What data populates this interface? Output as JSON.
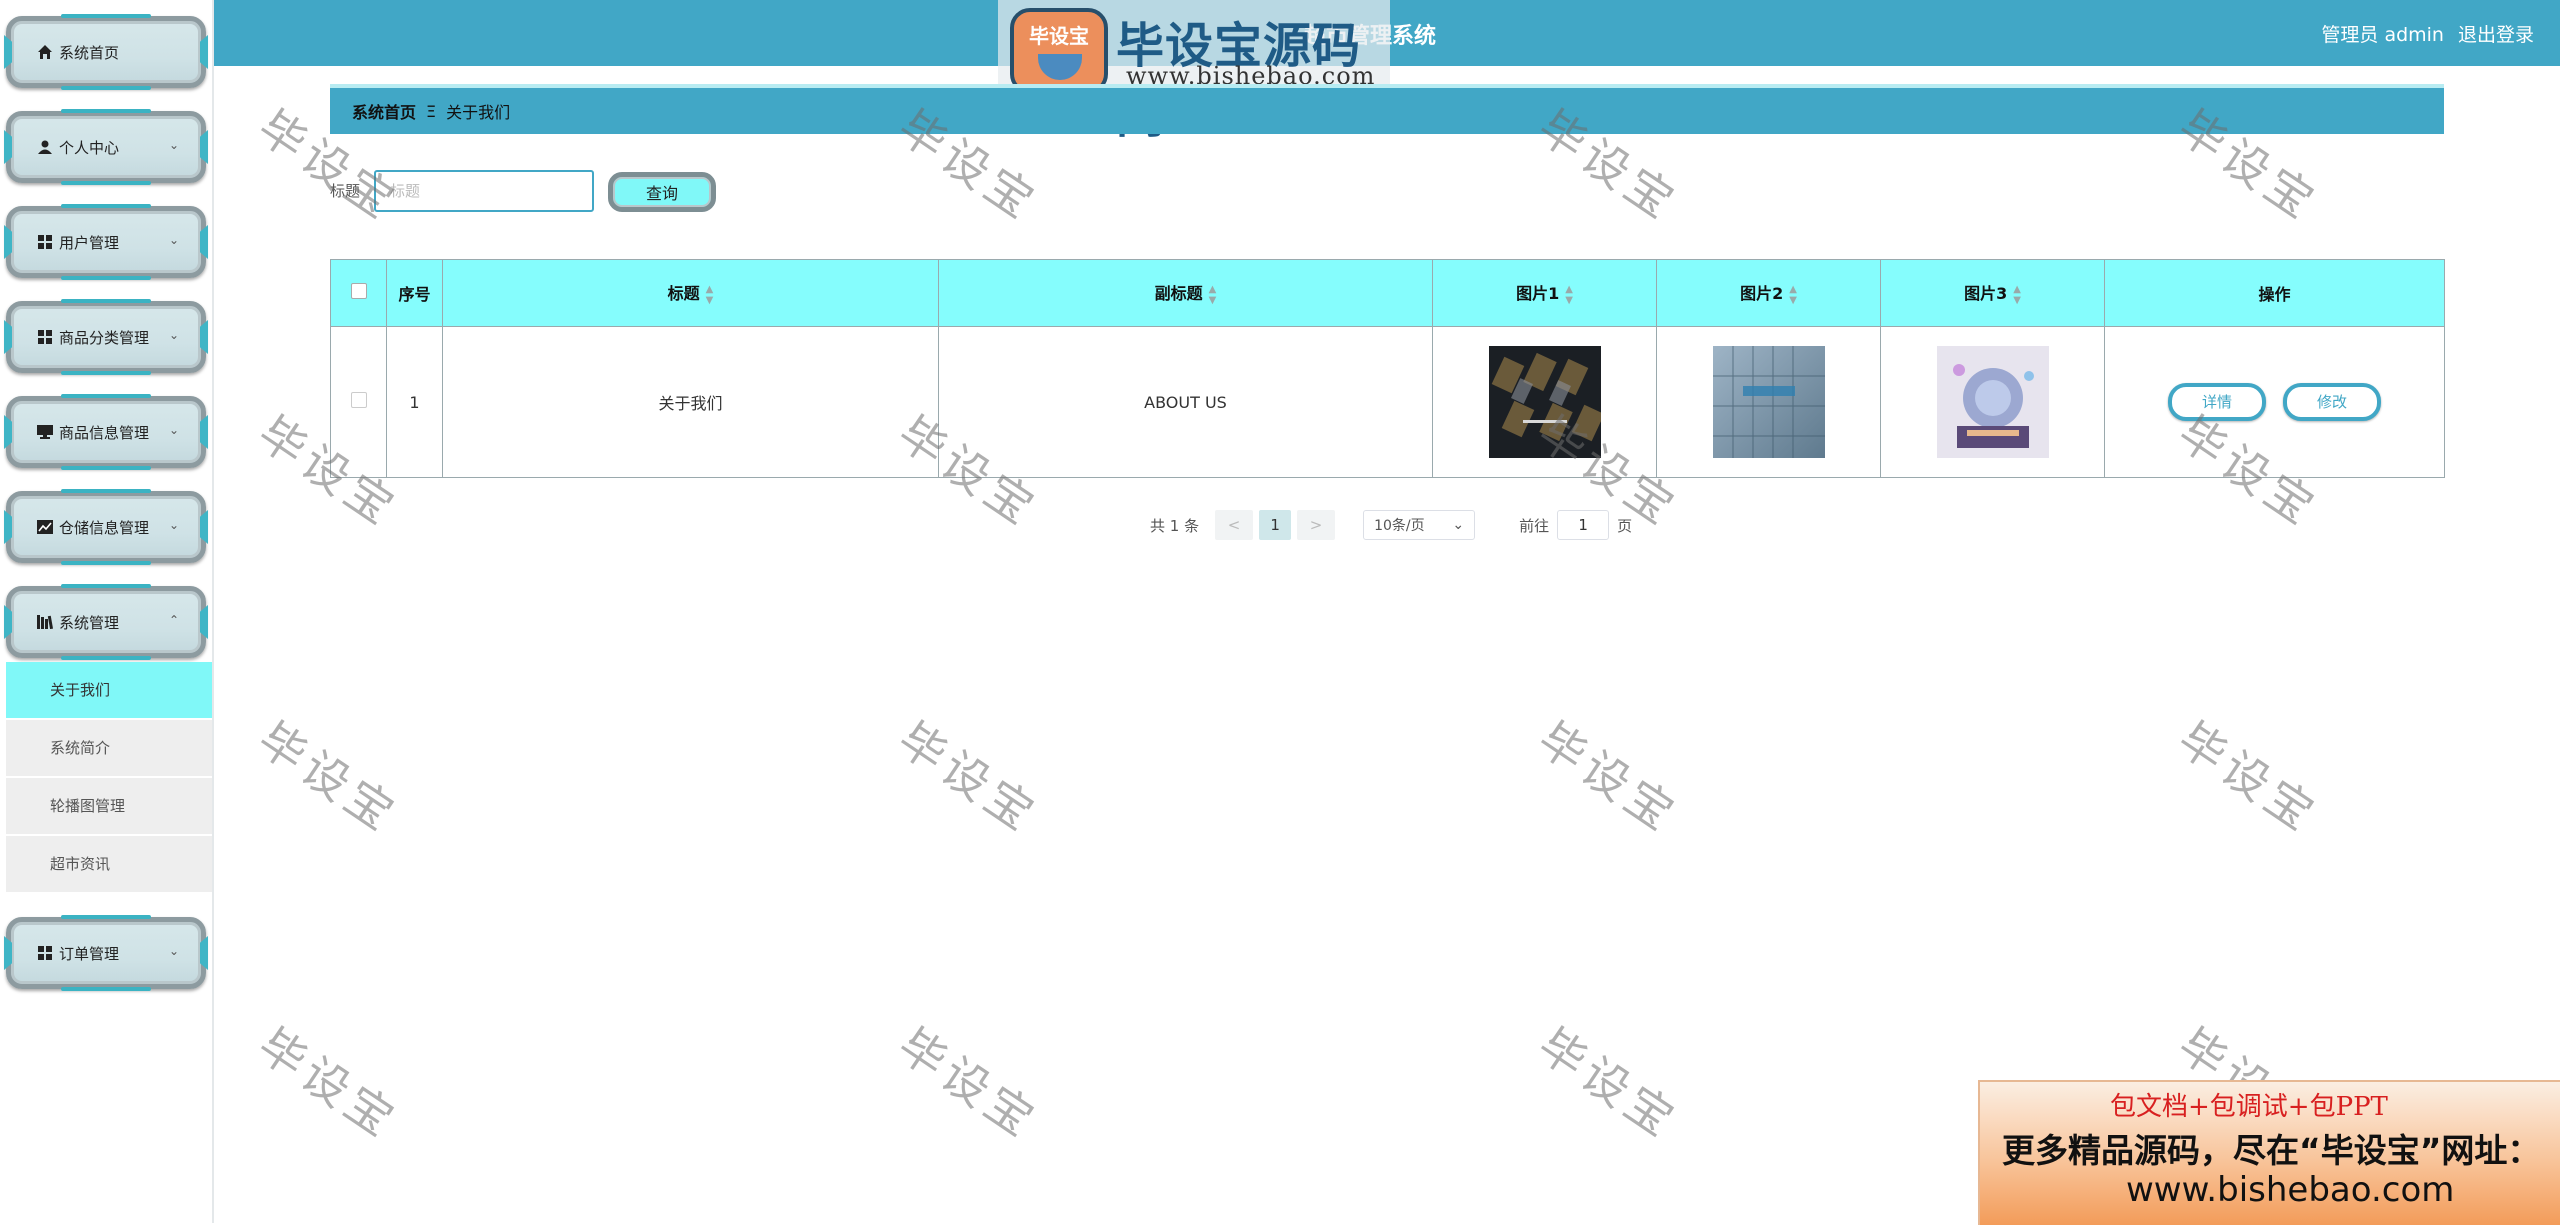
{
  "app": {
    "title": "超市管理系统",
    "user_label": "管理员 admin",
    "logout_label": "退出登录"
  },
  "logo": {
    "badge_text": "毕设宝",
    "name": "毕设宝源码网",
    "url": "www.bishebao.com"
  },
  "sidebar": {
    "items": [
      {
        "label": "系统首页"
      },
      {
        "label": "个人中心"
      },
      {
        "label": "用户管理"
      },
      {
        "label": "商品分类管理"
      },
      {
        "label": "商品信息管理"
      },
      {
        "label": "仓储信息管理"
      },
      {
        "label": "系统管理"
      },
      {
        "label": "订单管理"
      }
    ],
    "submenu": [
      {
        "label": "关于我们",
        "active": true
      },
      {
        "label": "系统简介"
      },
      {
        "label": "轮播图管理"
      },
      {
        "label": "超市资讯"
      }
    ]
  },
  "breadcrumb": {
    "home": "系统首页",
    "separator": "Ξ",
    "current": "关于我们"
  },
  "search": {
    "label": "标题",
    "placeholder": "标题",
    "button": "查询"
  },
  "table": {
    "headers": {
      "index": "序号",
      "title": "标题",
      "subtitle": "副标题",
      "pic1": "图片1",
      "pic2": "图片2",
      "pic3": "图片3",
      "actions": "操作"
    },
    "rows": [
      {
        "index": "1",
        "title": "关于我们",
        "subtitle": "ABOUT US",
        "detail_label": "详情",
        "edit_label": "修改"
      }
    ]
  },
  "pagination": {
    "total": "共 1 条",
    "prev": "<",
    "next": ">",
    "current_page": "1",
    "page_size": "10条/页",
    "goto_prefix": "前往",
    "goto_value": "1",
    "goto_suffix": "页"
  },
  "watermark_text": "毕设宝",
  "ad": {
    "line1": "包文档+包调试+包PPT",
    "line2": "更多精品源码，尽在“毕设宝”网址：",
    "line3": "www.bishebao.com"
  },
  "colors": {
    "primary": "#41a7c6",
    "header_bg": "#85fdfd",
    "active_menu": "#80f8f8"
  }
}
